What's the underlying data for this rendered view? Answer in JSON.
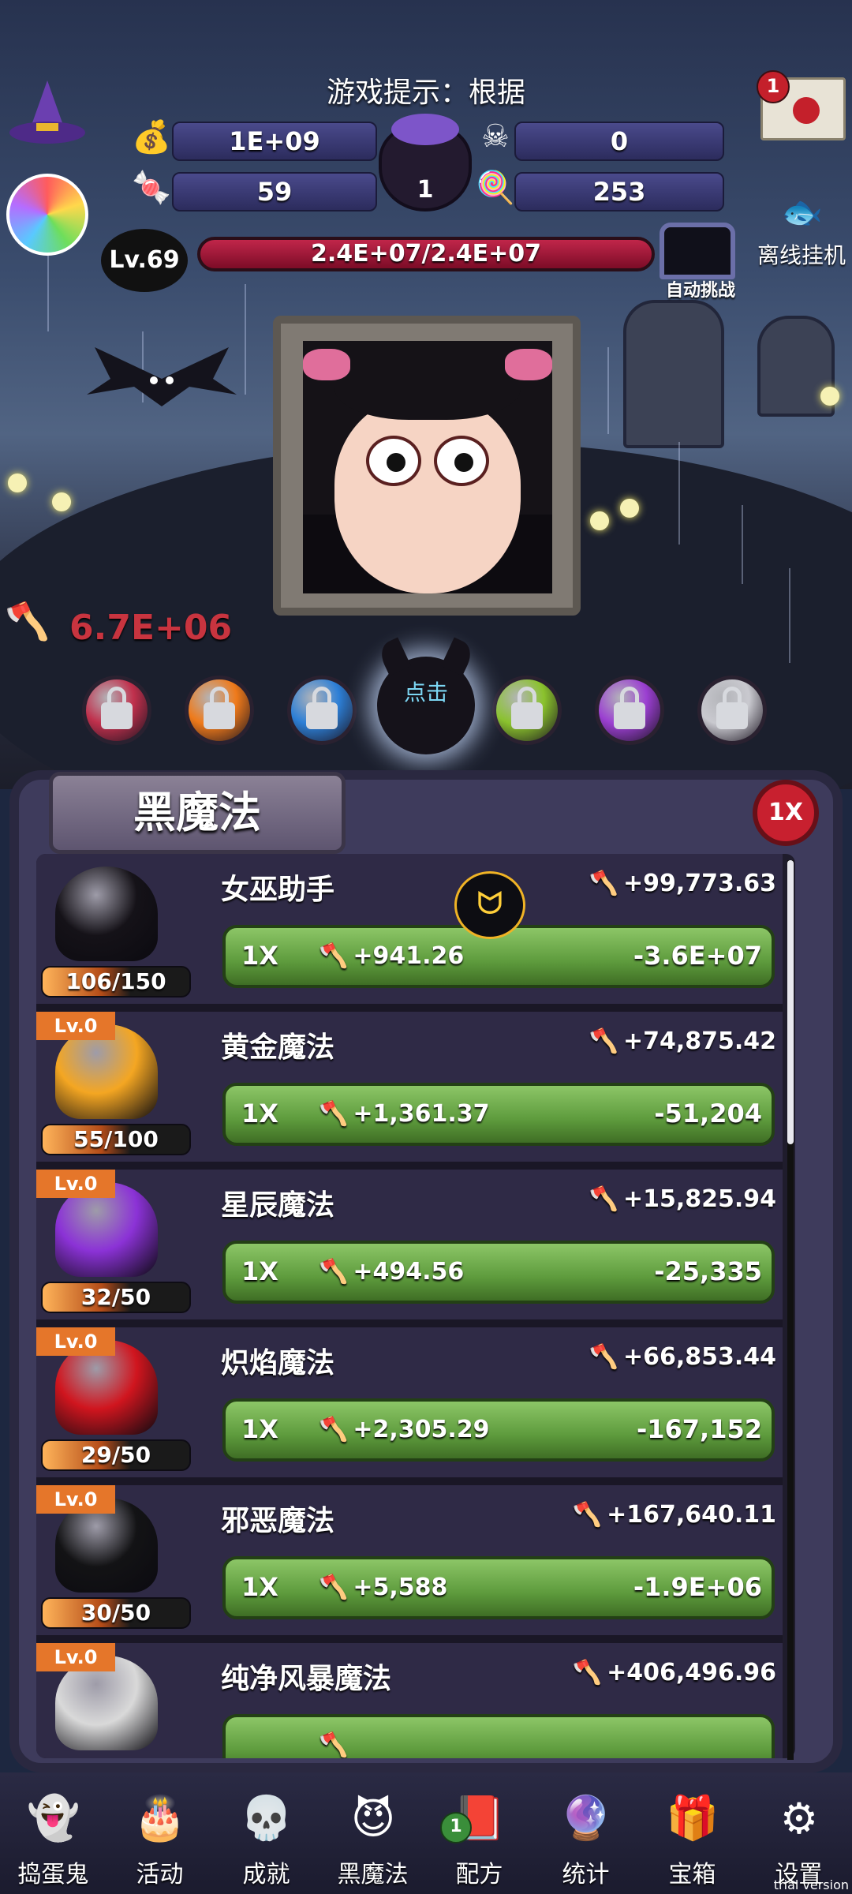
{
  "hint": "游戏提示：根据",
  "resources": {
    "gold": "1E+09",
    "skull_potion": "0",
    "candy_blood": "59",
    "candy_corn": "253",
    "cauldron_count": "1"
  },
  "mail": {
    "badge": "1"
  },
  "offline_label": "离线挂机",
  "level_badge": "Lv.69",
  "hp": "2.4E+07/2.4E+07",
  "auto_challenge": "自动挑战",
  "damage_popup": "6.7E+06",
  "tap_label": "点击",
  "panel": {
    "title": "黑魔法",
    "multiplier": "1X"
  },
  "items": [
    {
      "name": "女巫助手",
      "level": "",
      "count": "106/150",
      "dmg": "+99,773.63",
      "mult": "1X",
      "gain": "+941.26",
      "cost": "-3.6E+07",
      "color": "#151218"
    },
    {
      "name": "黄金魔法",
      "level": "Lv.0",
      "count": "55/100",
      "dmg": "+74,875.42",
      "mult": "1X",
      "gain": "+1,361.37",
      "cost": "-51,204",
      "color": "#f4a622"
    },
    {
      "name": "星辰魔法",
      "level": "Lv.0",
      "count": "32/50",
      "dmg": "+15,825.94",
      "mult": "1X",
      "gain": "+494.56",
      "cost": "-25,335",
      "color": "#8b32d6"
    },
    {
      "name": "炽焰魔法",
      "level": "Lv.0",
      "count": "29/50",
      "dmg": "+66,853.44",
      "mult": "1X",
      "gain": "+2,305.29",
      "cost": "-167,152",
      "color": "#d0151e"
    },
    {
      "name": "邪恶魔法",
      "level": "Lv.0",
      "count": "30/50",
      "dmg": "+167,640.11",
      "mult": "1X",
      "gain": "+5,588",
      "cost": "-1.9E+06",
      "color": "#131315"
    },
    {
      "name": "纯净风暴魔法",
      "level": "Lv.0",
      "count": "",
      "dmg": "+406,496.96",
      "mult": "",
      "gain": "",
      "cost": "",
      "color": "#d9d9d9"
    }
  ],
  "orbs": [
    {
      "color": "#c0304c",
      "state": "locked"
    },
    {
      "color": "#ef7a1a",
      "state": "locked"
    },
    {
      "color": "#2d7fd6",
      "state": "locked"
    },
    {
      "color": "#8ac22c",
      "state": "locked"
    },
    {
      "color": "#9b3fd1",
      "state": "locked"
    },
    {
      "color": "#c9c9cf",
      "state": "locked"
    }
  ],
  "nav": [
    {
      "label": "捣蛋鬼",
      "icon": "ghost-icon",
      "glyph": "👻",
      "badge": ""
    },
    {
      "label": "活动",
      "icon": "eyeball-cake-icon",
      "glyph": "🎂",
      "badge": ""
    },
    {
      "label": "成就",
      "icon": "skull-trophy-icon",
      "glyph": "💀",
      "badge": ""
    },
    {
      "label": "黑魔法",
      "icon": "black-cat-icon",
      "glyph": "😈",
      "badge": ""
    },
    {
      "label": "配方",
      "icon": "recipe-book-icon",
      "glyph": "📕",
      "badge": "1"
    },
    {
      "label": "统计",
      "icon": "crystal-ball-icon",
      "glyph": "🔮",
      "badge": ""
    },
    {
      "label": "宝箱",
      "icon": "treasure-chest-icon",
      "glyph": "🎁",
      "badge": ""
    },
    {
      "label": "设置",
      "icon": "gear-icon",
      "glyph": "⚙",
      "badge": ""
    }
  ],
  "trial": "trial version"
}
